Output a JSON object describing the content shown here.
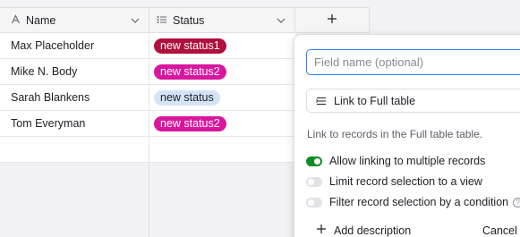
{
  "header": {
    "name_label": "Name",
    "status_label": "Status",
    "add_label": "+"
  },
  "rows": [
    {
      "name": "Max Placeholder",
      "status": "new status1",
      "status_color": "#b0103c",
      "status_text_color": "#ffffff"
    },
    {
      "name": "Mike N. Body",
      "status": "new status2",
      "status_color": "#d8179f",
      "status_text_color": "#ffffff"
    },
    {
      "name": "Sarah Blankens",
      "status": "new status",
      "status_color": "#d4e4f7",
      "status_text_color": "#1d1f25"
    },
    {
      "name": "Tom Everyman",
      "status": "new status2",
      "status_color": "#d8179f",
      "status_text_color": "#ffffff"
    }
  ],
  "panel": {
    "field_placeholder": "Field name (optional)",
    "field_value": "",
    "link_label": "Link to Full table",
    "description": "Link to records in the Full table table.",
    "options": [
      {
        "label": "Allow linking to multiple records",
        "enabled": true
      },
      {
        "label": "Limit record selection to a view",
        "enabled": false
      },
      {
        "label": "Filter record selection by a condition",
        "enabled": false
      }
    ],
    "add_description_label": "Add description",
    "cancel_label": "Cancel"
  },
  "colors": {
    "accent": "#2d7ff9",
    "toggle_on": "#0f8a26"
  }
}
